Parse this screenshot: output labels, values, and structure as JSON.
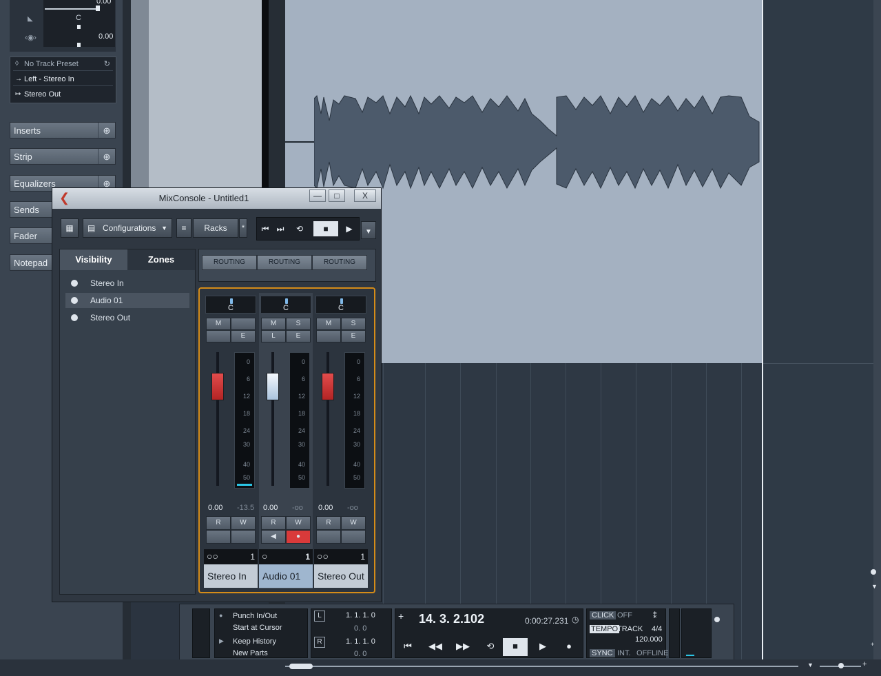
{
  "inspector": {
    "volume_value": "0.00",
    "pan_value": "C",
    "pan_value2": "0.00",
    "track_preset": "No Track Preset",
    "input_routing": "Left - Stereo In",
    "output_routing": "Stereo Out",
    "sections": [
      "Inserts",
      "Strip",
      "Equalizers",
      "Sends",
      "Fader",
      "Notepad"
    ]
  },
  "mixconsole": {
    "title": "MixConsole - Untitled1",
    "window_buttons": {
      "minimize": "—",
      "maximize": "□",
      "close": "X"
    },
    "configurations_label": "Configurations",
    "racks_label": "Racks",
    "racks_star": "*",
    "tabs": [
      "Visibility",
      "Zones"
    ],
    "visibility_items": [
      "Stereo In",
      "Audio 01",
      "Stereo Out"
    ],
    "routing_labels": [
      "ROUTING",
      "ROUTING",
      "ROUTING"
    ],
    "meter_scale": [
      "0",
      "6",
      "12",
      "18",
      "24",
      "30",
      "40",
      "50"
    ],
    "channels": [
      {
        "name": "Stereo In",
        "pan": "C",
        "buttons": [
          "M",
          "",
          "",
          "E"
        ],
        "fader_value": "0.00",
        "peak_value": "-13.5",
        "rw": [
          "R",
          "W"
        ],
        "number": "1",
        "fader_color": "#d23b3b"
      },
      {
        "name": "Audio 01",
        "pan": "C",
        "buttons": [
          "M",
          "S",
          "L",
          "E"
        ],
        "fader_value": "0.00",
        "peak_value": "-oo",
        "rw": [
          "R",
          "W"
        ],
        "number": "1",
        "fader_color": "#e8eef6"
      },
      {
        "name": "Stereo Out",
        "pan": "C",
        "buttons": [
          "M",
          "S",
          "",
          "E"
        ],
        "fader_value": "0.00",
        "peak_value": "-oo",
        "rw": [
          "R",
          "W"
        ],
        "number": "1",
        "fader_color": "#d23b3b"
      }
    ]
  },
  "transport": {
    "punch": "Punch In/Out",
    "start_at_cursor": "Start at Cursor",
    "keep_history": "Keep History",
    "new_parts": "New Parts",
    "left_locator": "1. 1. 1. 0",
    "left_locator_sub": "0. 0",
    "right_locator": "1. 1. 1. 0",
    "right_locator_sub": "0. 0",
    "position_bars": "14. 3. 2.102",
    "position_time": "0:00:27.231",
    "click_label": "CLICK",
    "click_state": "OFF",
    "tempo_label": "TEMPO",
    "tempo_mode": "TRACK",
    "signature": "4/4",
    "tempo_value": "120.000",
    "sync_label": "SYNC",
    "sync_mode": "INT.",
    "sync_state": "OFFLINE"
  }
}
